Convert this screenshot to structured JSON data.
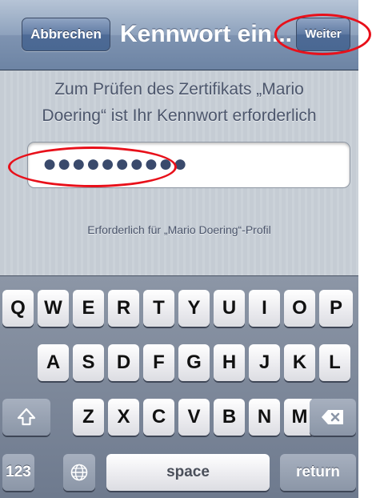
{
  "navbar": {
    "cancel_label": "Abbrechen",
    "title": "Kennwort ein...",
    "next_label": "Weiter"
  },
  "prompt": {
    "line1": "Zum Prüfen des Zertifikats „Mario",
    "line2": "Doering“ ist Ihr Kennwort erforderlich"
  },
  "password_field": {
    "value": "●●●●●●●●●●"
  },
  "hint": "Erforderlich für „Mario Doering“-Profil",
  "keyboard": {
    "row1": [
      "Q",
      "W",
      "E",
      "R",
      "T",
      "Y",
      "U",
      "I",
      "O",
      "P"
    ],
    "row2": [
      "A",
      "S",
      "D",
      "F",
      "G",
      "H",
      "J",
      "K",
      "L"
    ],
    "row3": [
      "Z",
      "X",
      "C",
      "V",
      "B",
      "N",
      "M"
    ],
    "numbers_label": "123",
    "space_label": "space",
    "return_label": "return",
    "shift_icon": "shift-icon",
    "delete_icon": "backspace-icon",
    "globe_icon": "globe-icon"
  },
  "colors": {
    "annotation": "#e8101a",
    "navbar": "#6d84a4",
    "background": "#c5ccd4"
  }
}
